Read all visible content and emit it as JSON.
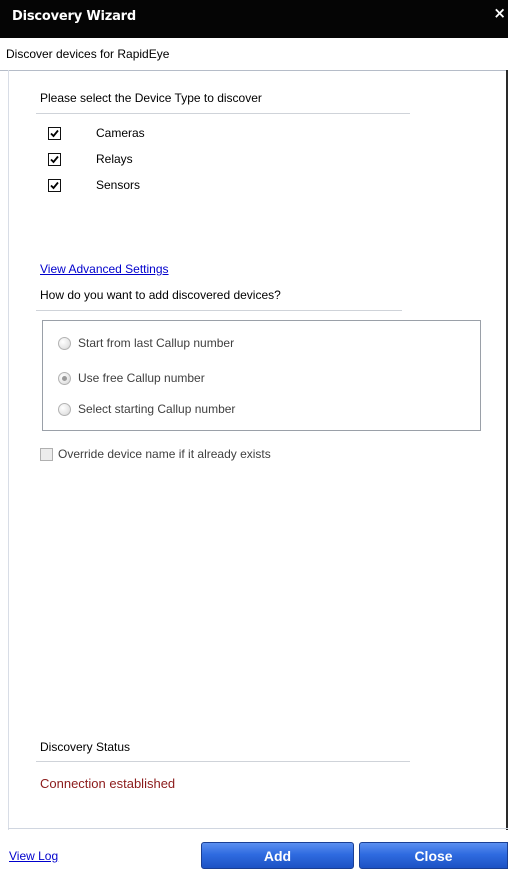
{
  "window": {
    "title": "Discovery Wizard",
    "close_glyph": "×"
  },
  "header": {
    "subtitle": "Discover devices for RapidEye"
  },
  "device_types": {
    "heading": "Please select the Device Type to discover",
    "items": [
      {
        "label": "Cameras",
        "checked": true
      },
      {
        "label": "Relays",
        "checked": true
      },
      {
        "label": "Sensors",
        "checked": true
      }
    ]
  },
  "advanced": {
    "link": "View Advanced Settings",
    "question": "How do you want to  add discovered devices?",
    "options": [
      {
        "label": "Start from last Callup number",
        "selected": false
      },
      {
        "label": "Use free Callup number",
        "selected": true
      },
      {
        "label": "Select starting Callup number",
        "selected": false
      }
    ],
    "override_label": "Override device name if it already exists"
  },
  "status": {
    "heading": "Discovery Status",
    "text": "Connection established",
    "text_color": "#8b1a1a"
  },
  "footer": {
    "view_log": "View Log",
    "add": "Add",
    "close": "Close"
  },
  "colors": {
    "titlebar": "#050505",
    "link": "#0000cc",
    "button": "#2f6be0"
  }
}
